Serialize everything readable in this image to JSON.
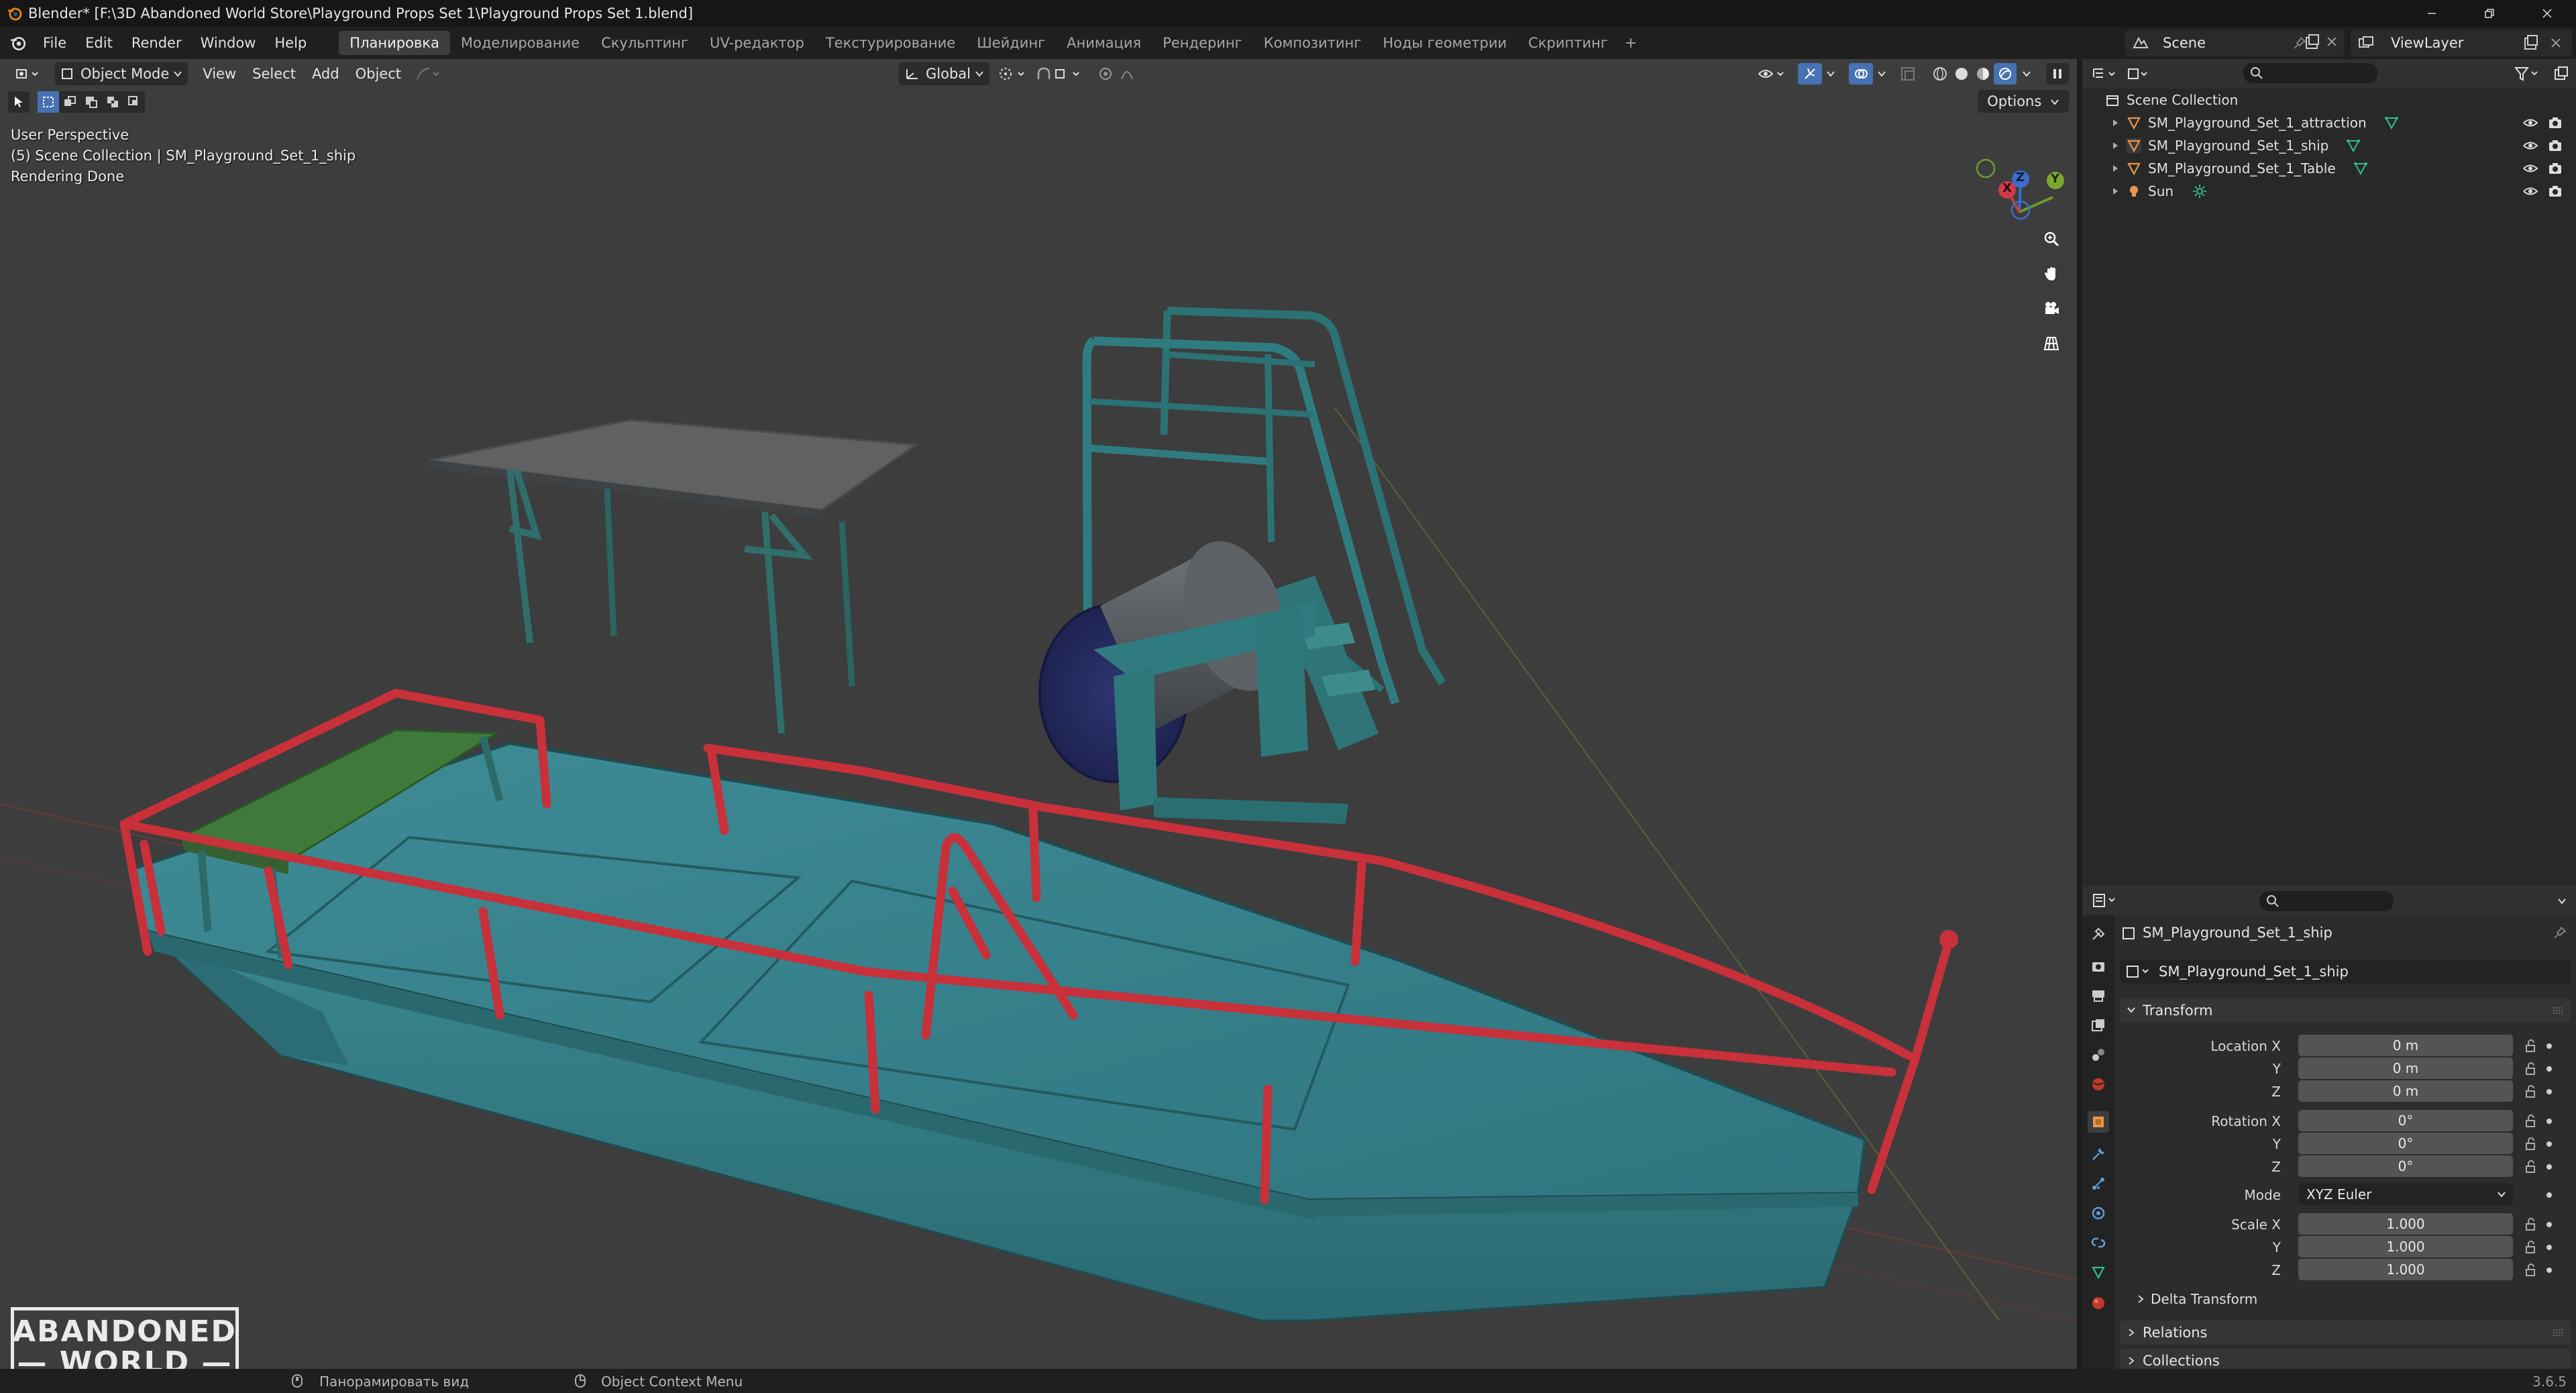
{
  "window": {
    "title": "Blender* [F:\\3D Abandoned World Store\\Playground Props Set 1\\Playground Props Set 1.blend]"
  },
  "menu": {
    "items": [
      "File",
      "Edit",
      "Render",
      "Window",
      "Help"
    ]
  },
  "workspaces": {
    "tabs": [
      "Планировка",
      "Моделирование",
      "Скульптинг",
      "UV-редактор",
      "Текстурирование",
      "Шейдинг",
      "Анимация",
      "Рендеринг",
      "Композитинг",
      "Ноды геометрии",
      "Скриптинг"
    ],
    "active": "Планировка",
    "add_icon": "plus-icon"
  },
  "scene_selector": {
    "value": "Scene"
  },
  "viewlayer_selector": {
    "value": "ViewLayer"
  },
  "viewport": {
    "mode": "Object Mode",
    "menus": [
      "View",
      "Select",
      "Add",
      "Object"
    ],
    "orientation": "Global",
    "options_label": "Options",
    "info_lines": [
      "User Perspective",
      "(5) Scene Collection | SM_Playground_Set_1_ship",
      "Rendering Done"
    ],
    "gizmo": {
      "x": "X",
      "y": "Y",
      "z": "Z"
    },
    "colors": {
      "background": "#3d3d3d",
      "hull": "#3b8a93",
      "rail": "#c8303a",
      "bench": "#3f7a3a"
    }
  },
  "logo": {
    "line1": "ABANDONED",
    "line2": "WORLD"
  },
  "outliner": {
    "collection": "Scene Collection",
    "items": [
      {
        "name": "SM_Playground_Set_1_attraction",
        "type": "mesh"
      },
      {
        "name": "SM_Playground_Set_1_ship",
        "type": "mesh"
      },
      {
        "name": "SM_Playground_Set_1_Table",
        "type": "mesh"
      },
      {
        "name": "Sun",
        "type": "light"
      }
    ]
  },
  "properties": {
    "object_name": "SM_Playground_Set_1_ship",
    "data_name": "SM_Playground_Set_1_ship",
    "transform": {
      "title": "Transform",
      "location_label": "Location X",
      "location": [
        "0 m",
        "0 m",
        "0 m"
      ],
      "rotation_label": "Rotation X",
      "rotation": [
        "0°",
        "0°",
        "0°"
      ],
      "mode_label": "Mode",
      "mode": "XYZ Euler",
      "scale_label": "Scale X",
      "scale": [
        "1.000",
        "1.000",
        "1.000"
      ],
      "y": "Y",
      "z": "Z"
    },
    "subpanels": [
      "Delta Transform",
      "Relations",
      "Collections"
    ]
  },
  "statusbar": {
    "pan": "Панорамировать вид",
    "context": "Object Context Menu",
    "version": "3.6.5"
  }
}
